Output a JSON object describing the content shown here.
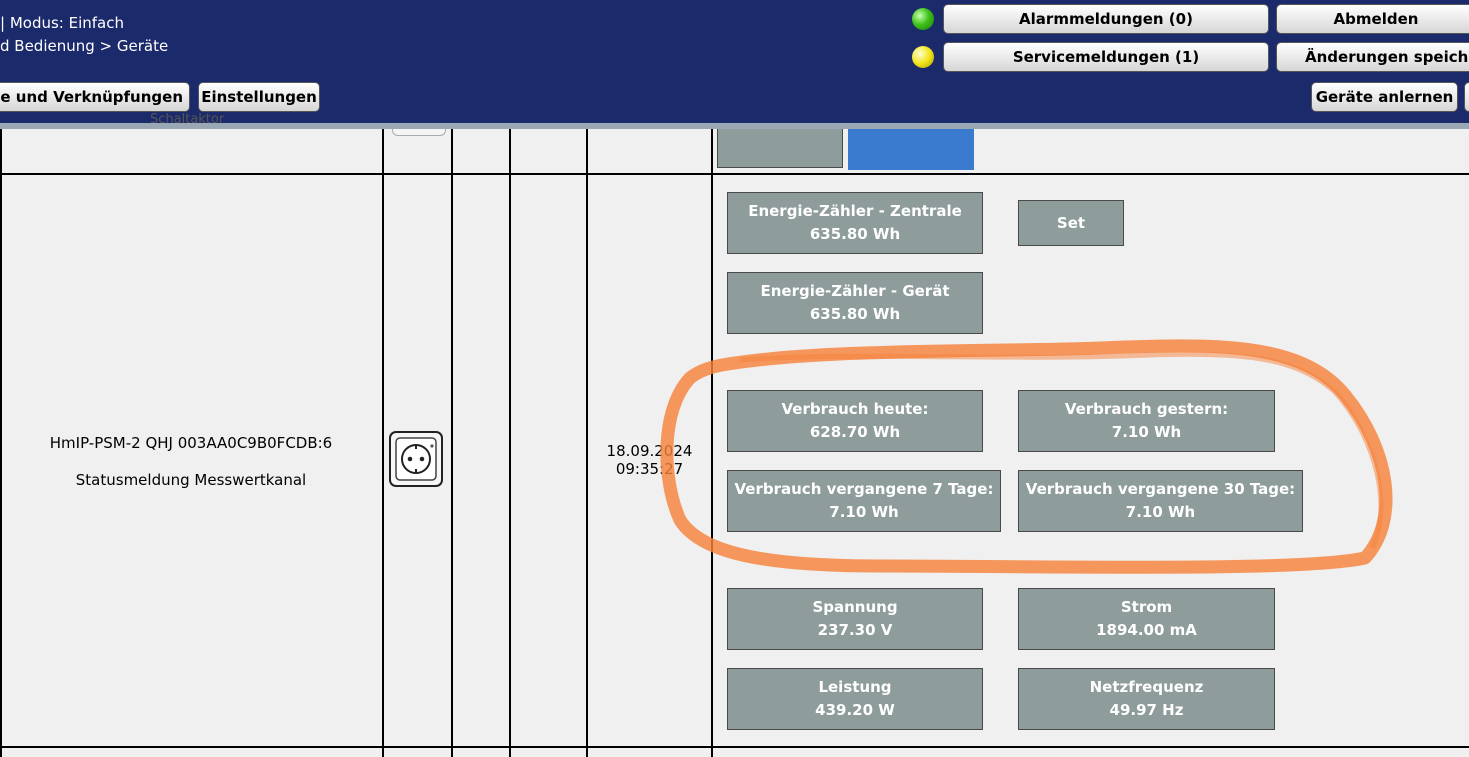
{
  "header": {
    "mode_text": "| Modus: Einfach",
    "breadcrumb": "d Bedienung > Geräte",
    "alarm_label": "Alarmmeldungen (0)",
    "service_label": "Servicemeldungen (1)",
    "logout_label": "Abmelden",
    "save_label": "Änderungen speiche",
    "programs_label": "me und Verknüpfungen",
    "settings_label": "Einstellungen",
    "teach_label": "Geräte anlernen",
    "alarm_led_color": "#3ec21a",
    "service_led_color": "#f2e419"
  },
  "top_row": {
    "partial_label": "Schaltaktor"
  },
  "device": {
    "name": "HmIP-PSM-2 QHJ 003AA0C9B0FCDB:6",
    "channel": "Statusmeldung Messwertkanal",
    "icon": "power-socket-icon",
    "date": "18.09.2024",
    "time": "09:35:27"
  },
  "set_label": "Set",
  "tiles": [
    {
      "label": "Energie-Zähler - Zentrale",
      "value": "635.80 Wh"
    },
    {
      "label": "Energie-Zähler - Gerät",
      "value": "635.80 Wh"
    },
    {
      "label": "Verbrauch heute:",
      "value": "628.70 Wh"
    },
    {
      "label": "Verbrauch gestern:",
      "value": "7.10 Wh"
    },
    {
      "label": "Verbrauch vergangene 7 Tage:",
      "value": "7.10 Wh"
    },
    {
      "label": "Verbrauch vergangene 30 Tage:",
      "value": "7.10 Wh"
    },
    {
      "label": "Spannung",
      "value": "237.30 V"
    },
    {
      "label": "Strom",
      "value": "1894.00 mA"
    },
    {
      "label": "Leistung",
      "value": "439.20 W"
    },
    {
      "label": "Netzfrequenz",
      "value": "49.97 Hz"
    }
  ],
  "colors": {
    "header": "#1b2a6b",
    "tile": "#8f9c9c",
    "tile_blue": "#3a7bd0",
    "highlight": "#f5823c"
  }
}
